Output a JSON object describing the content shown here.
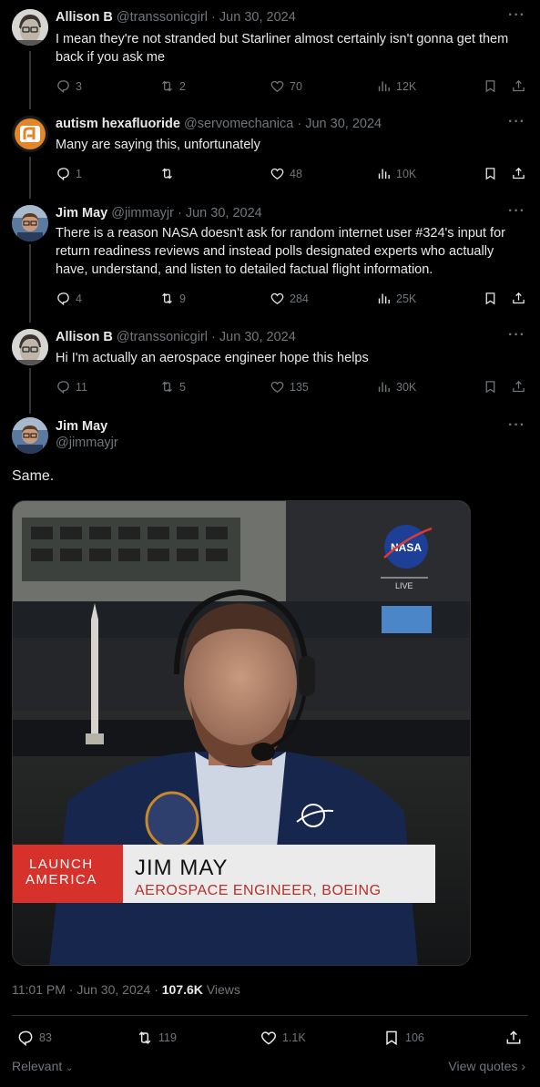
{
  "tweets": [
    {
      "name": "Allison B",
      "handle": "@transsonicgirl",
      "date": "Jun 30, 2024",
      "text": "I mean they're not stranded but Starliner almost certainly isn't gonna get them back if you ask me",
      "replies": "3",
      "reposts": "2",
      "likes": "70",
      "views": "12K"
    },
    {
      "name": "autism hexafluoride",
      "handle": "@servomechanica",
      "date": "Jun 30, 2024",
      "text": "Many are saying this, unfortunately",
      "replies": "1",
      "reposts": "",
      "likes": "48",
      "views": "10K"
    },
    {
      "name": "Jim May",
      "handle": "@jimmayjr",
      "date": "Jun 30, 2024",
      "text": "There is a reason NASA doesn't ask for random internet user #324's input for return readiness reviews and instead polls designated experts who actually have, understand, and listen to detailed factual flight information.",
      "replies": "4",
      "reposts": "9",
      "likes": "284",
      "views": "25K"
    },
    {
      "name": "Allison B",
      "handle": "@transsonicgirl",
      "date": "Jun 30, 2024",
      "text": "Hi I'm actually an aerospace engineer hope this helps",
      "replies": "11",
      "reposts": "5",
      "likes": "135",
      "views": "30K"
    }
  ],
  "main": {
    "name": "Jim May",
    "handle": "@jimmayjr",
    "text": "Same.",
    "media": {
      "live_tag": "LIVE",
      "nasa_logo": "NASA",
      "lower_third_left_1": "LAUNCH",
      "lower_third_left_2": "AMERICA",
      "lower_third_name": "JIM MAY",
      "lower_third_title": "AEROSPACE ENGINEER, BOEING"
    },
    "time": "11:01 PM",
    "date": "Jun 30, 2024",
    "views_count": "107.6K",
    "views_label": "Views",
    "replies": "83",
    "reposts": "119",
    "likes": "1.1K",
    "bookmarks": "106"
  },
  "footer": {
    "sort_label": "Relevant",
    "view_quotes": "View quotes"
  },
  "separator_dot": "·",
  "colors": {
    "background": "#000000",
    "text": "#e7e9ea",
    "muted": "#71767b",
    "lower_third_red": "#d7312b"
  }
}
